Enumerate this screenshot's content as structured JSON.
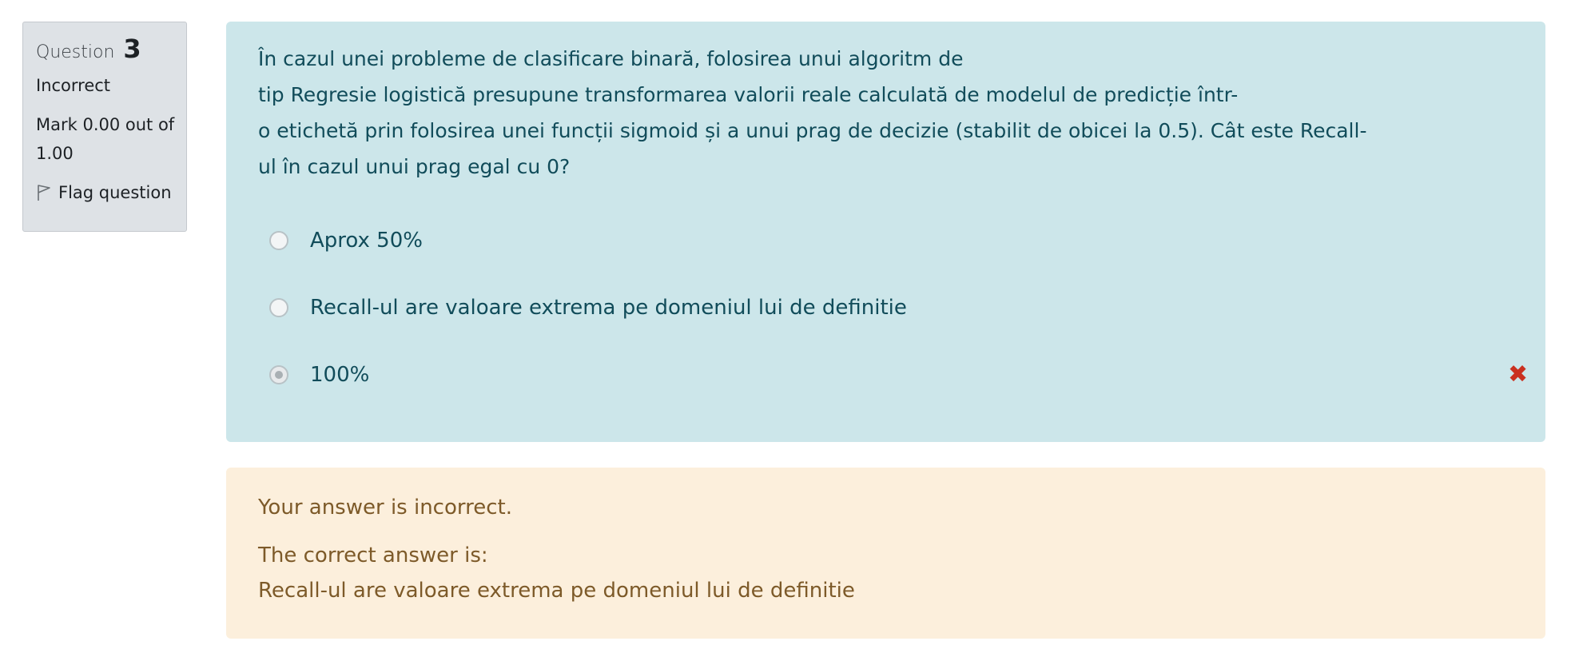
{
  "info": {
    "question_label": "Question",
    "question_number": "3",
    "state": "Incorrect",
    "grade": "Mark 0.00 out of 1.00",
    "flag_label": "Flag question",
    "flag_icon": "flag-outline-icon"
  },
  "question": {
    "text_lines": [
      "În cazul unei probleme de clasificare binară, folosirea unui algoritm de",
      "tip Regresie logistică presupune transformarea valorii reale calculată de modelul de predicție într-",
      "o etichetă prin folosirea unei funcții sigmoid și a unui prag de decizie (stabilit de obicei la 0.5). Cât este Recall-",
      "ul în cazul unui prag egal cu 0?"
    ],
    "answers": [
      {
        "label": "Aprox 50%",
        "checked": false
      },
      {
        "label": "Recall-ul are valoare extrema pe domeniul lui de definitie",
        "checked": false
      },
      {
        "label": "100%",
        "checked": true
      }
    ],
    "incorrect_icon": "cross-icon"
  },
  "feedback": {
    "general": "Your answer is incorrect.",
    "right_answer_intro": "The correct answer is:",
    "right_answer": "Recall-ul are valoare extrema pe domeniul lui de definitie"
  },
  "colors": {
    "info_bg": "#dee2e6",
    "question_bg": "#cce6ea",
    "question_text": "#114c5a",
    "feedback_bg": "#fcefdc",
    "feedback_text": "#7d5a29",
    "incorrect_icon": "#ca3120"
  }
}
